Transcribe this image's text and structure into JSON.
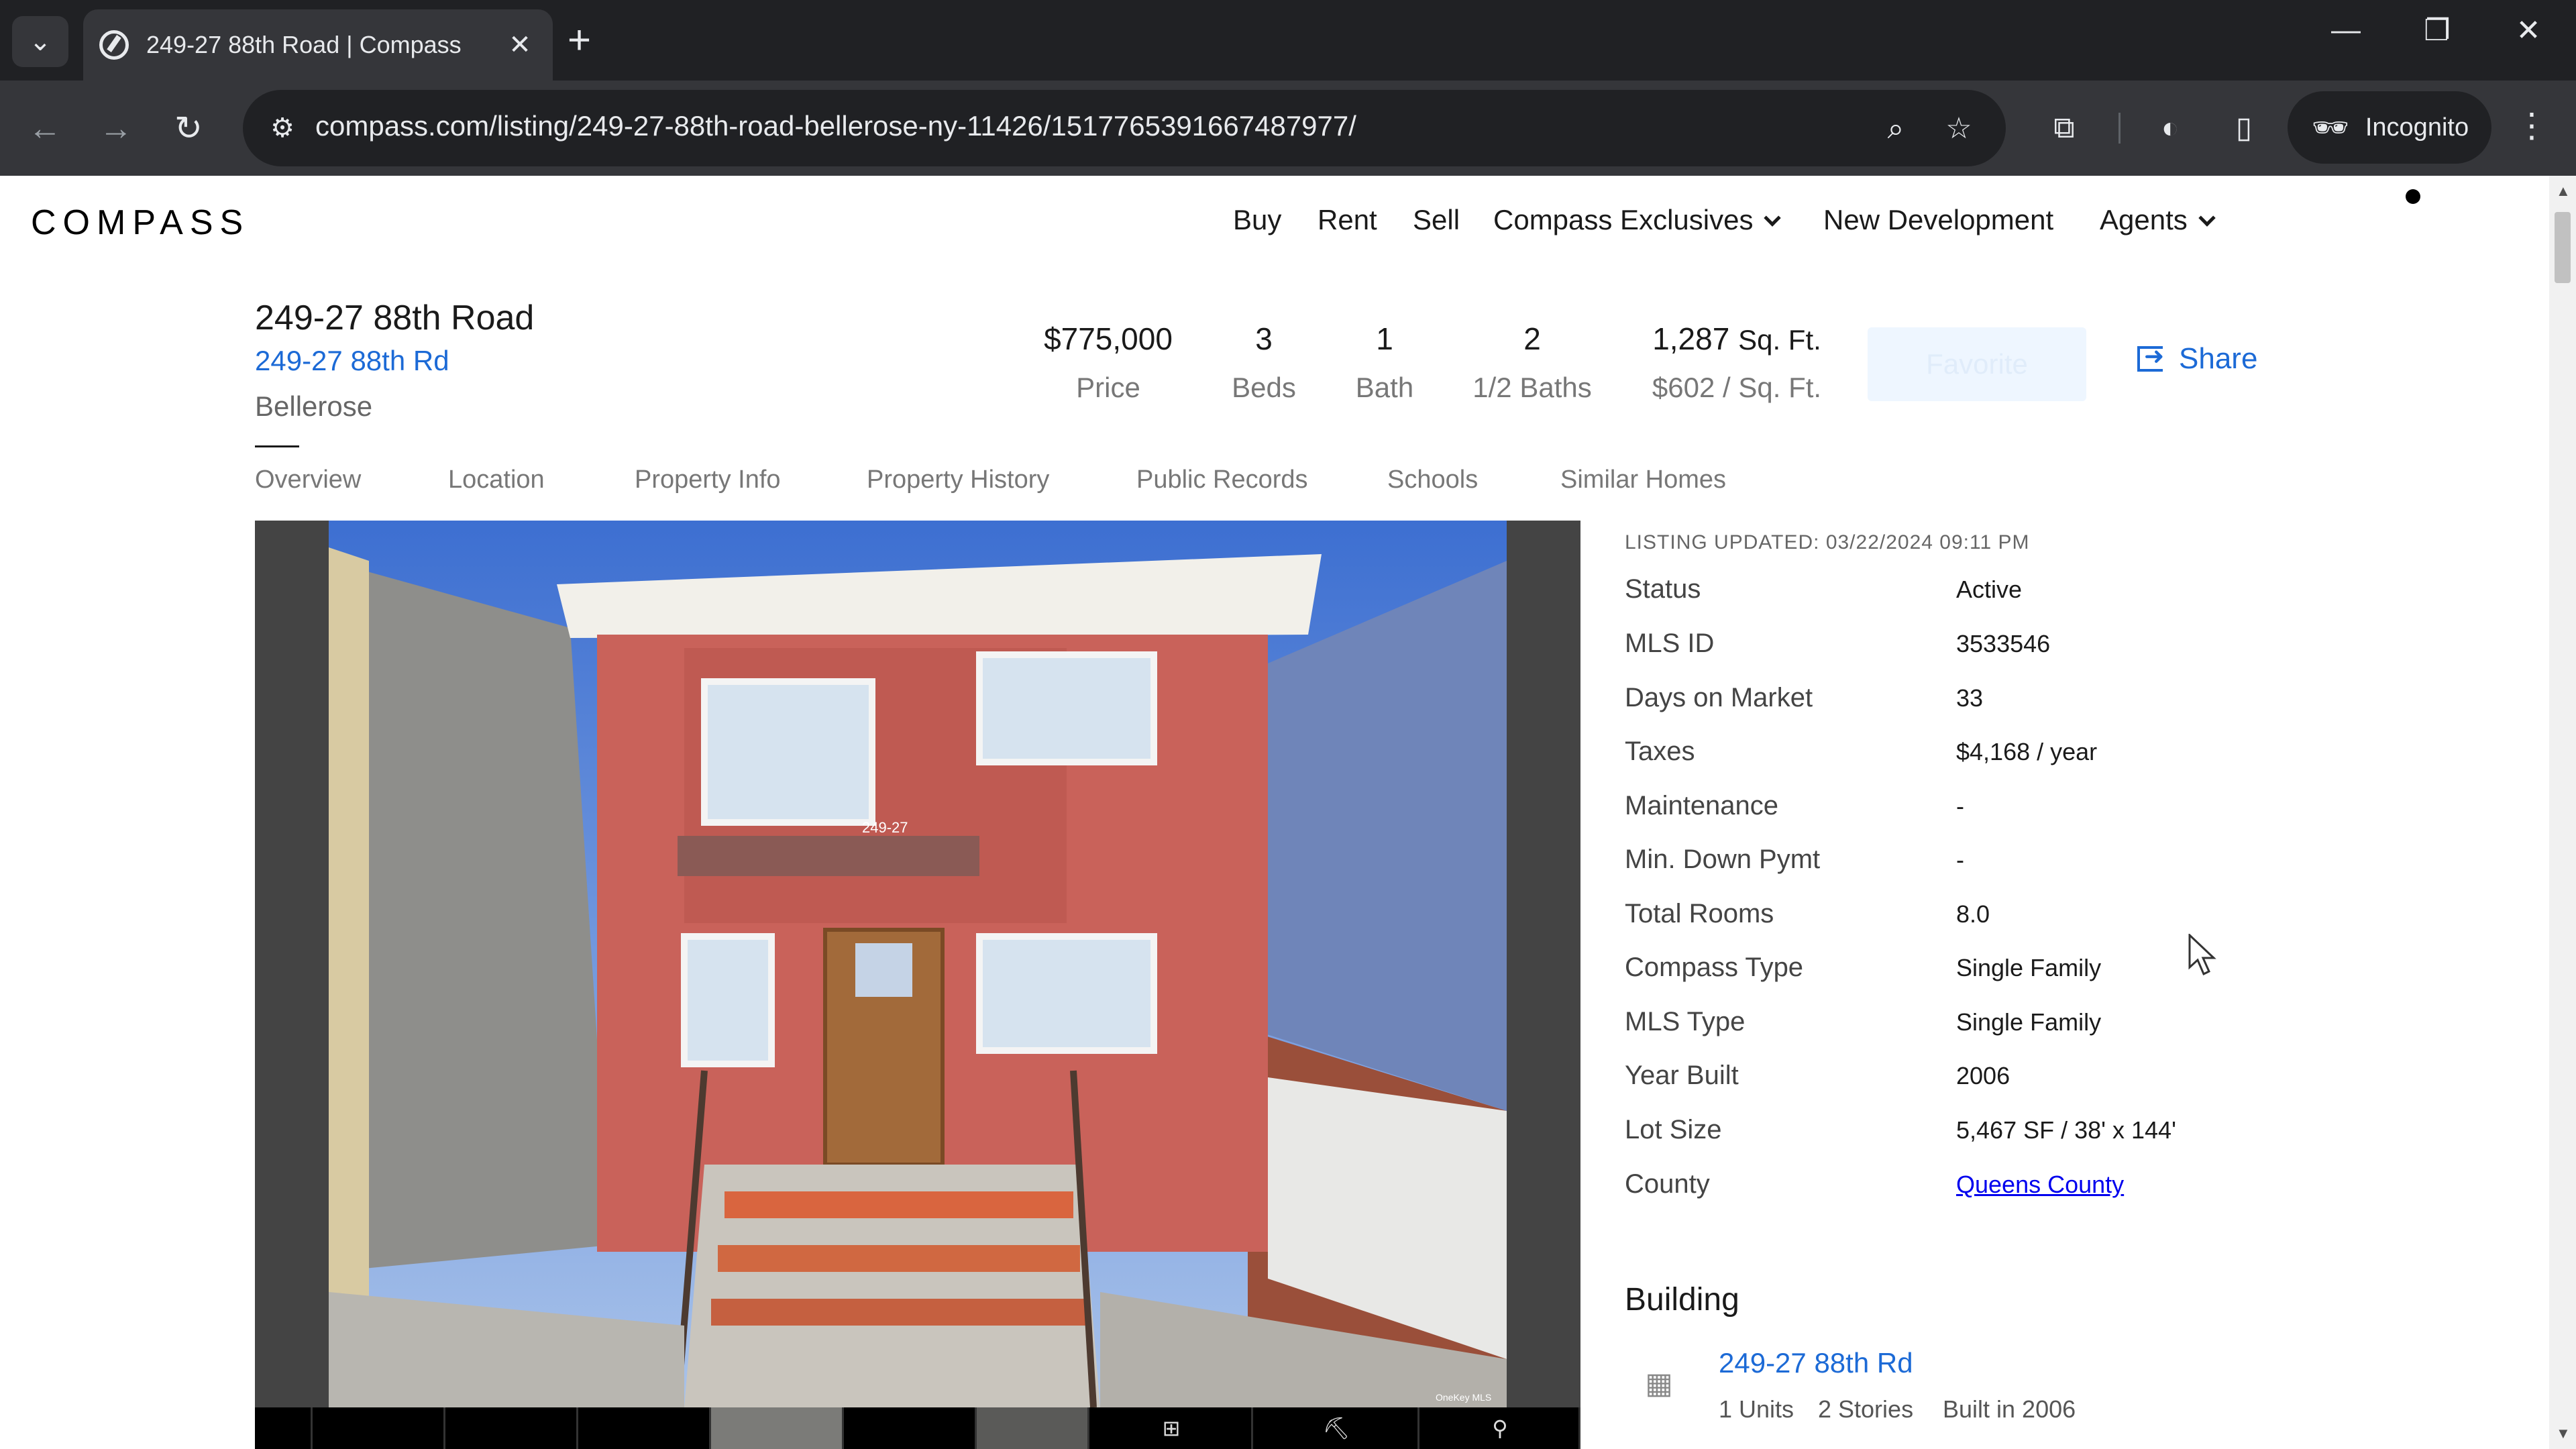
{
  "browser": {
    "tab_title": "249-27 88th Road | Compass",
    "url": "compass.com/listing/249-27-88th-road-bellerose-ny-11426/1517765391667487977/",
    "incognito_label": "Incognito",
    "icons": {
      "tab_search": "chevron-down-icon",
      "favicon": "compass-favicon",
      "tab_close": "close-icon",
      "new_tab": "plus-icon",
      "minimize": "minimize-icon",
      "restore": "restore-icon",
      "window_close": "close-icon",
      "back": "back-arrow-icon",
      "forward": "forward-arrow-icon",
      "reload": "reload-icon",
      "site_info": "tune-icon",
      "zoom": "magnifier-icon",
      "bookmark": "star-icon",
      "extensions": "puzzle-icon",
      "performance": "gauge-icon",
      "side_panel": "side-panel-icon",
      "menu": "kebab-icon"
    }
  },
  "site": {
    "logo": "COMPASS",
    "nav": {
      "buy": "Buy",
      "rent": "Rent",
      "sell": "Sell",
      "exclusives": "Compass Exclusives",
      "new_development": "New Development",
      "agents": "Agents"
    }
  },
  "listing": {
    "title": "249-27 88th Road",
    "address_link": "249-27 88th Rd",
    "city": "Bellerose",
    "stats": {
      "price_value": "$775,000",
      "price_label": "Price",
      "beds_value": "3",
      "beds_label": "Beds",
      "bath_value": "1",
      "bath_label": "Bath",
      "half_baths_value": "2",
      "half_baths_label": "1/2 Baths",
      "sqft_value": "1,287",
      "sqft_unit": "Sq. Ft.",
      "price_per_sqft": "$602 / Sq. Ft."
    },
    "favorite_label": "Favorite",
    "share_label": "Share",
    "subnav": [
      "Overview",
      "Location",
      "Property Info",
      "Property History",
      "Public Records",
      "Schools",
      "Similar Homes"
    ],
    "updated": "LISTING UPDATED: 03/22/2024 09:11 PM",
    "facts": [
      {
        "label": "Status",
        "value": "Active"
      },
      {
        "label": "MLS ID",
        "value": "3533546"
      },
      {
        "label": "Days on Market",
        "value": "33"
      },
      {
        "label": "Taxes",
        "value": "$4,168 / year"
      },
      {
        "label": "Maintenance",
        "value": "-"
      },
      {
        "label": "Min. Down Pymt",
        "value": "-"
      },
      {
        "label": "Total Rooms",
        "value": "8.0"
      },
      {
        "label": "Compass Type",
        "value": "Single Family"
      },
      {
        "label": "MLS Type",
        "value": "Single Family"
      },
      {
        "label": "Year Built",
        "value": "2006"
      },
      {
        "label": "Lot Size",
        "value": "5,467 SF / 38' x 144'"
      },
      {
        "label": "County",
        "value": "Queens County"
      }
    ],
    "photo_number": "249-27",
    "photo_watermark": "OneKey MLS",
    "building": {
      "heading": "Building",
      "name": "249-27 88th Rd",
      "units": "1 Units",
      "stories": "2 Stories",
      "built": "Built in 2006"
    }
  },
  "colors": {
    "link_blue": "#1c6ad6",
    "chrome_dark": "#202124",
    "chrome_mid": "#35363a"
  }
}
